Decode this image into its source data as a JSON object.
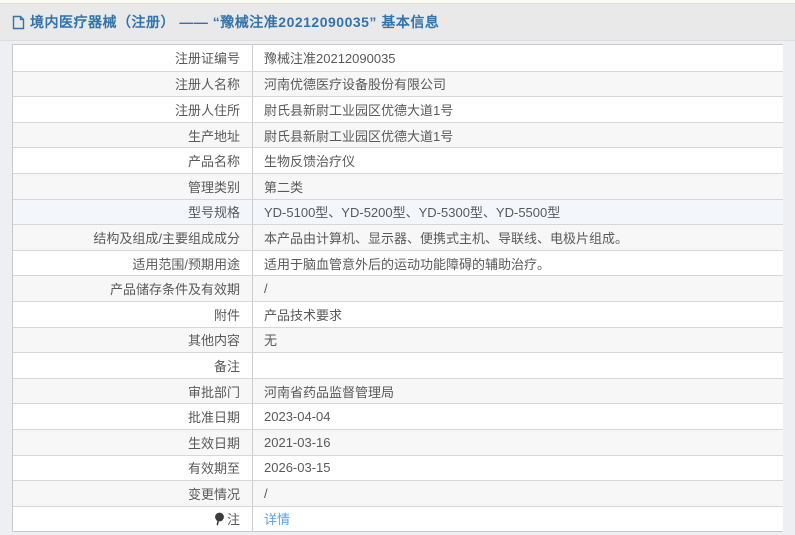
{
  "header": {
    "icon": "document-icon",
    "title": "境内医疗器械（注册） —— “豫械注准20212090035” 基本信息"
  },
  "colors": {
    "title_blue": "#3273ab",
    "link_blue": "#57a2e0",
    "zebra_gray": "#f7f7f7",
    "highlight_blue": "#f3f6fb"
  },
  "table": {
    "rows": [
      {
        "label": "注册证编号",
        "value": "豫械注准20212090035"
      },
      {
        "label": "注册人名称",
        "value": "河南优德医疗设备股份有限公司"
      },
      {
        "label": "注册人住所",
        "value": "尉氏县新尉工业园区优德大道1号"
      },
      {
        "label": "生产地址",
        "value": "尉氏县新尉工业园区优德大道1号"
      },
      {
        "label": "产品名称",
        "value": "生物反馈治疗仪"
      },
      {
        "label": "管理类别",
        "value": "第二类"
      },
      {
        "label": "型号规格",
        "value": "YD-5100型、YD-5200型、YD-5300型、YD-5500型",
        "highlighted": true
      },
      {
        "label": "结构及组成/主要组成成分",
        "value": "本产品由计算机、显示器、便携式主机、导联线、电极片组成。"
      },
      {
        "label": "适用范围/预期用途",
        "value": "适用于脑血管意外后的运动功能障碍的辅助治疗。"
      },
      {
        "label": "产品储存条件及有效期",
        "value": "/"
      },
      {
        "label": "附件",
        "value": "产品技术要求"
      },
      {
        "label": "其他内容",
        "value": "无"
      },
      {
        "label": "备注",
        "value": ""
      },
      {
        "label": "审批部门",
        "value": "河南省药品监督管理局"
      },
      {
        "label": "批准日期",
        "value": "2023-04-04"
      },
      {
        "label": "生效日期",
        "value": "2021-03-16"
      },
      {
        "label": "有效期至",
        "value": "2026-03-15"
      },
      {
        "label": "变更情况",
        "value": "/"
      },
      {
        "label": "注",
        "icon": "note-icon",
        "value": "详情",
        "value_is_link": true
      }
    ]
  }
}
